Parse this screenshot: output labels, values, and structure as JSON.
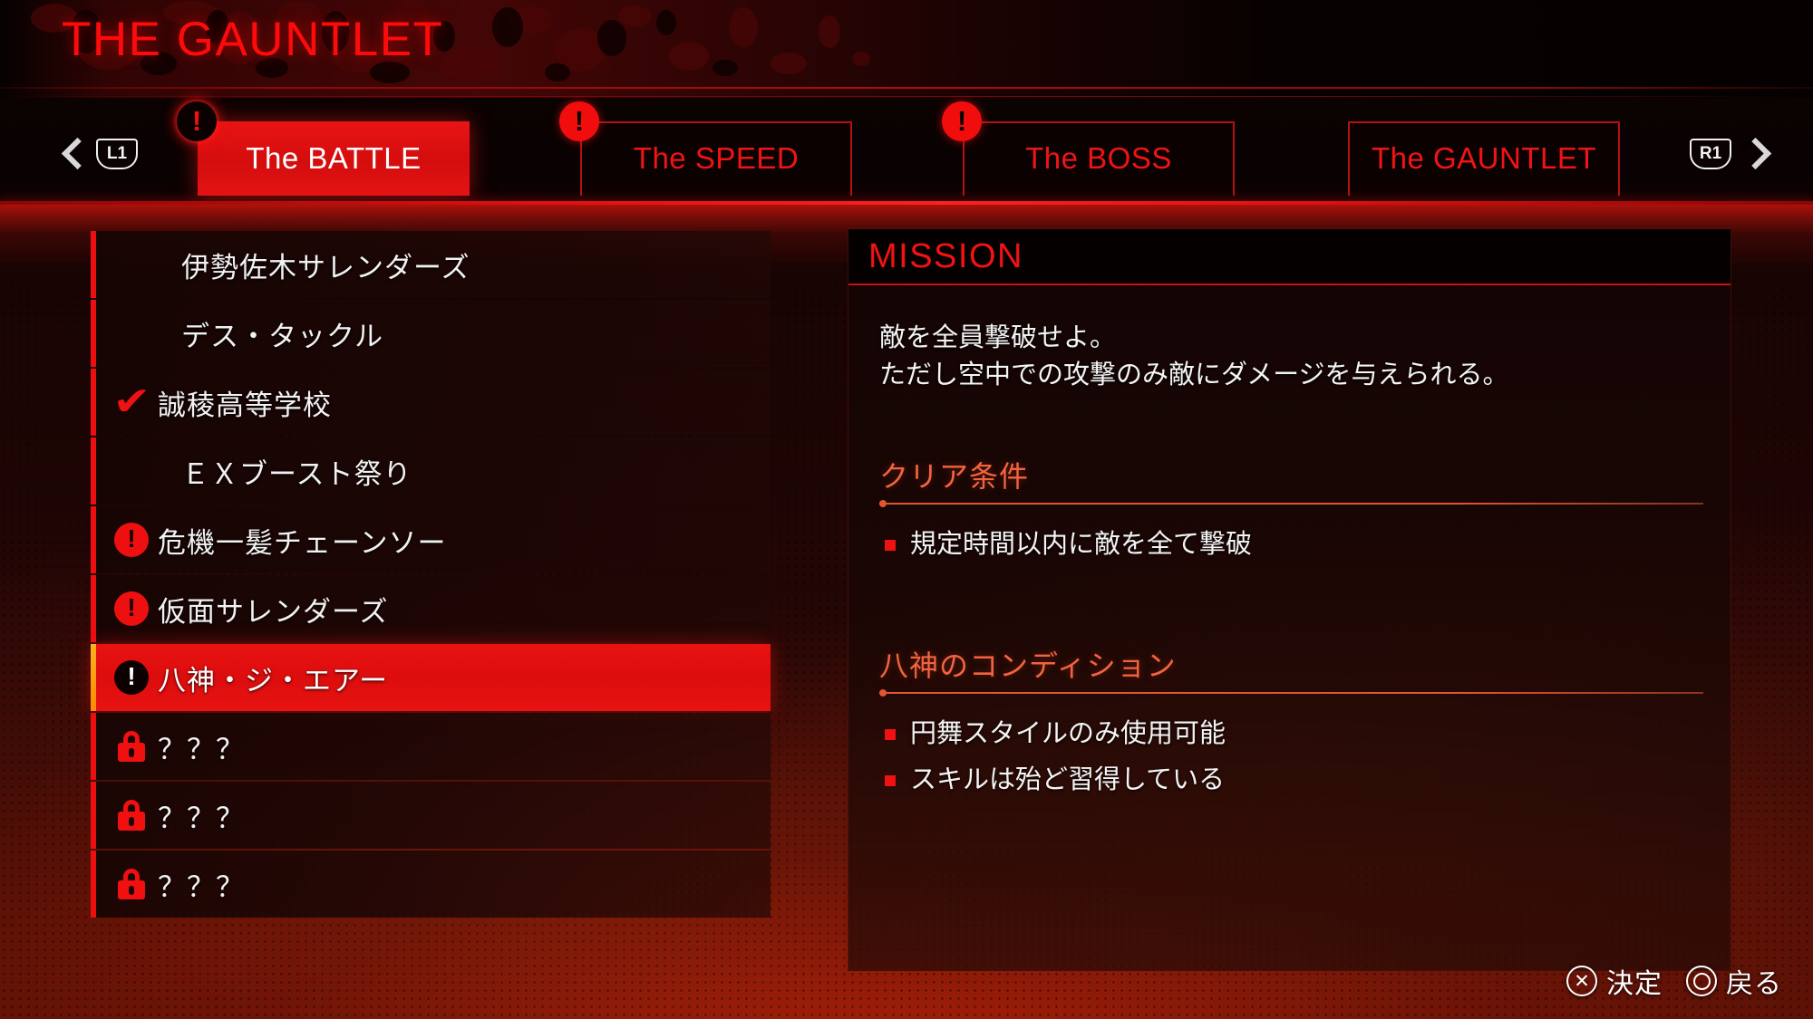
{
  "header": {
    "title": "THE GAUNTLET"
  },
  "nav": {
    "left_button": "L1",
    "right_button": "R1",
    "left_arrow_icon": "chevron-left-icon",
    "right_arrow_icon": "chevron-right-icon"
  },
  "tabs": [
    {
      "label": "The BATTLE",
      "selected": true,
      "badge": "!"
    },
    {
      "label": "The SPEED",
      "selected": false,
      "badge": "!"
    },
    {
      "label": "The BOSS",
      "selected": false,
      "badge": "!"
    },
    {
      "label": "The GAUNTLET",
      "selected": false,
      "badge": ""
    }
  ],
  "mission_list": [
    {
      "label": "伊勢佐木サレンダーズ",
      "icon": "none",
      "selected": false
    },
    {
      "label": "デス・タックル",
      "icon": "none",
      "selected": false
    },
    {
      "label": "誠稜高等学校",
      "icon": "check",
      "selected": false
    },
    {
      "label": "ＥＸブースト祭り",
      "icon": "none",
      "selected": false
    },
    {
      "label": "危機一髪チェーンソー",
      "icon": "bang",
      "selected": false
    },
    {
      "label": "仮面サレンダーズ",
      "icon": "bang",
      "selected": false
    },
    {
      "label": "八神・ジ・エアー",
      "icon": "bang",
      "selected": true
    },
    {
      "label": "？？？",
      "icon": "lock",
      "selected": false
    },
    {
      "label": "？？？",
      "icon": "lock",
      "selected": false
    },
    {
      "label": "？？？",
      "icon": "lock",
      "selected": false
    }
  ],
  "mission_panel": {
    "header": "MISSION",
    "description": "敵を全員撃破せよ。\nただし空中での攻撃のみ敵にダメージを与えられる。",
    "sections": [
      {
        "title": "クリア条件",
        "items": [
          "規定時間以内に敵を全て撃破"
        ]
      },
      {
        "title": "八神のコンディション",
        "items": [
          "円舞スタイルのみ使用可能",
          "スキルは殆ど習得している"
        ]
      }
    ]
  },
  "footer": {
    "confirm_icon": "cross-button-icon",
    "confirm_label": "決定",
    "back_icon": "circle-button-icon",
    "back_label": "戻る"
  },
  "colors": {
    "accent_red": "#f01212",
    "bright_red": "#e81212",
    "section_orange": "#f2633f",
    "selected_edge": "#ffb020",
    "text_white": "#f4f4f4"
  }
}
